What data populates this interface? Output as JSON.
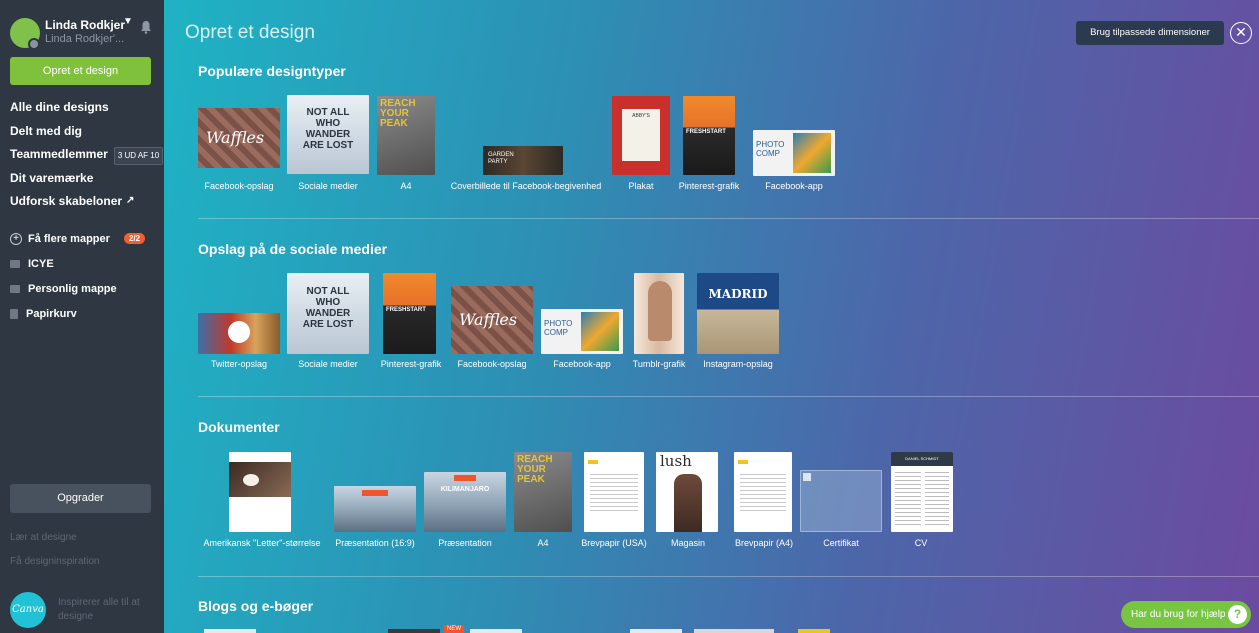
{
  "sidebar": {
    "user_name": "Linda Rodkjer",
    "user_sub": "Linda Rodkjer'...",
    "create_label": "Opret et design",
    "nav": [
      {
        "label": "Alle dine designs"
      },
      {
        "label": "Delt med dig"
      },
      {
        "label": "Teammedlemmer",
        "badge": "3 UD AF 10"
      },
      {
        "label": "Dit varemærke"
      },
      {
        "label": "Udforsk skabeloner",
        "icon": "↗"
      }
    ],
    "folders": [
      {
        "label": "Få flere mapper",
        "badge": "2/2"
      },
      {
        "label": "ICYE"
      },
      {
        "label": "Personlig mappe"
      },
      {
        "label": "Papirkurv"
      }
    ],
    "upgrade_label": "Opgrader",
    "learn_label": "Lær at designe",
    "inspiration_label": "Få designinspiration",
    "logo_text": "Canva",
    "tagline": "Inspirerer alle til at designe"
  },
  "main": {
    "title": "Opret et design",
    "custom_dimensions_label": "Brug tilpassede dimensioner",
    "close_icon": "close-icon",
    "sections": [
      {
        "title": "Populære designtyper",
        "items": [
          {
            "label": "Facebook-opslag",
            "thumb_text": "Waffles",
            "color": "#8a5d5b"
          },
          {
            "label": "Sociale medier",
            "thumb_text": "NOT ALL WHO WANDER ARE LOST",
            "color": "#d5dfe8"
          },
          {
            "label": "A4",
            "thumb_text": "REACH YOUR PEAK",
            "color": "#6d6d6d"
          },
          {
            "label": "Coverbillede til Facebook-begivenhed",
            "thumb_text": "GARDEN PARTY",
            "color": "#3b3228"
          },
          {
            "label": "Plakat",
            "thumb_text": "ABBY'S",
            "color": "#c9302c"
          },
          {
            "label": "Pinterest-grafik",
            "thumb_text": "FRESHSTART",
            "color": "#e8712a"
          },
          {
            "label": "Facebook-app",
            "thumb_text": "PHOTO COMP",
            "color": "#f2f2f2"
          }
        ]
      },
      {
        "title": "Opslag på de sociale medier",
        "items": [
          {
            "label": "Twitter-opslag",
            "thumb_text": "",
            "color": "#c0392b"
          },
          {
            "label": "Sociale medier",
            "thumb_text": "NOT ALL WHO WANDER ARE LOST",
            "color": "#d5dfe8"
          },
          {
            "label": "Pinterest-grafik",
            "thumb_text": "FRESHSTART",
            "color": "#e8712a"
          },
          {
            "label": "Facebook-opslag",
            "thumb_text": "Waffles",
            "color": "#8a5d5b"
          },
          {
            "label": "Facebook-app",
            "thumb_text": "PHOTO COMP",
            "color": "#f2f2f2"
          },
          {
            "label": "Tumblr-grafik",
            "thumb_text": "",
            "color": "#f5e8dc"
          },
          {
            "label": "Instagram-opslag",
            "thumb_text": "MADRID",
            "color": "#1d4a86"
          }
        ]
      },
      {
        "title": "Dokumenter",
        "items": [
          {
            "label": "Amerikansk \"Letter\"-størrelse",
            "thumb_text": "",
            "color": "#ffffff"
          },
          {
            "label": "Præsentation (16:9)",
            "thumb_text": "",
            "color": "#a7b9c9"
          },
          {
            "label": "Præsentation",
            "thumb_text": "KILIMANJARO",
            "color": "#a7b9c9"
          },
          {
            "label": "A4",
            "thumb_text": "REACH YOUR PEAK",
            "color": "#6d6d6d"
          },
          {
            "label": "Brevpapir (USA)",
            "thumb_text": "",
            "color": "#ffffff"
          },
          {
            "label": "Magasin",
            "thumb_text": "lush",
            "color": "#ffffff"
          },
          {
            "label": "Brevpapir (A4)",
            "thumb_text": "",
            "color": "#ffffff"
          },
          {
            "label": "Certifikat",
            "thumb_text": "",
            "color": "#7a9cc4"
          },
          {
            "label": "CV",
            "thumb_text": "DANIEL SCHMIDT",
            "color": "#ffffff"
          }
        ]
      },
      {
        "title": "Blogs og e-bøger",
        "items": []
      }
    ],
    "new_badge": "NEW",
    "help_label": "Har du brug for hjælp",
    "help_icon": "?"
  },
  "colors": {
    "sidebar_bg": "#2f3742",
    "create_button": "#7fc13b",
    "help_button": "#78c542",
    "gradient_start": "#1fb3c4",
    "gradient_end": "#6c4a9f"
  }
}
